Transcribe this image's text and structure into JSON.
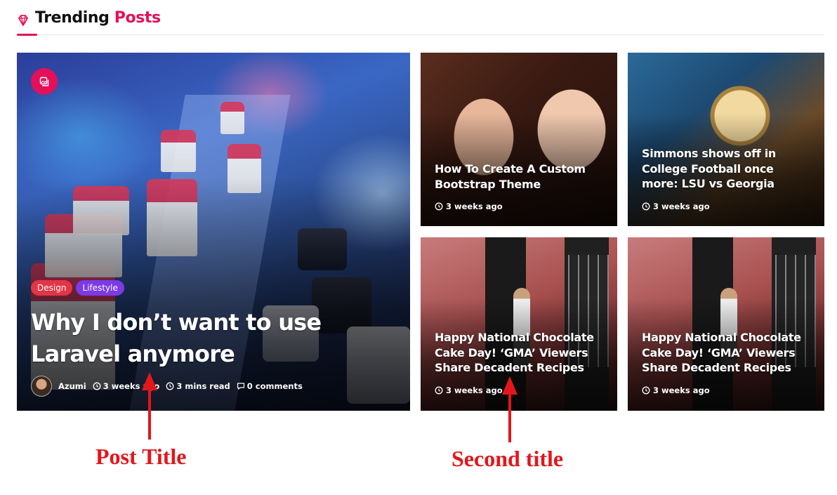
{
  "section": {
    "title_main": "Trending",
    "title_highlight": "Posts",
    "icon": "gem-icon"
  },
  "colors": {
    "accent": "#e5105a",
    "tag_design": "#e33546",
    "tag_lifestyle": "#7c3ae6",
    "annotation": "#e3161c"
  },
  "feature": {
    "format_icon": "image-gallery-icon",
    "tags": [
      "Design",
      "Lifestyle"
    ],
    "title": "Why I don’t want to use Laravel anymore",
    "author": "Azumi",
    "date": "3 weeks ago",
    "read_time": "3 mins read",
    "comments": "0 comments"
  },
  "posts": [
    {
      "title": "How To Create A Custom Bootstrap Theme",
      "date": "3 weeks ago"
    },
    {
      "title": "Simmons shows off in College Football once more: LSU vs Georgia",
      "date": "3 weeks ago"
    },
    {
      "title": "Happy National Chocolate Cake Day! ‘GMA’ Viewers Share Decadent Recipes",
      "date": "3 weeks ago"
    },
    {
      "title": "Happy National Chocolate Cake Day! ‘GMA’ Viewers Share Decadent Recipes",
      "date": "3 weeks ago"
    }
  ],
  "annotations": {
    "post_title": "Post Title",
    "second_title": "Second title"
  }
}
